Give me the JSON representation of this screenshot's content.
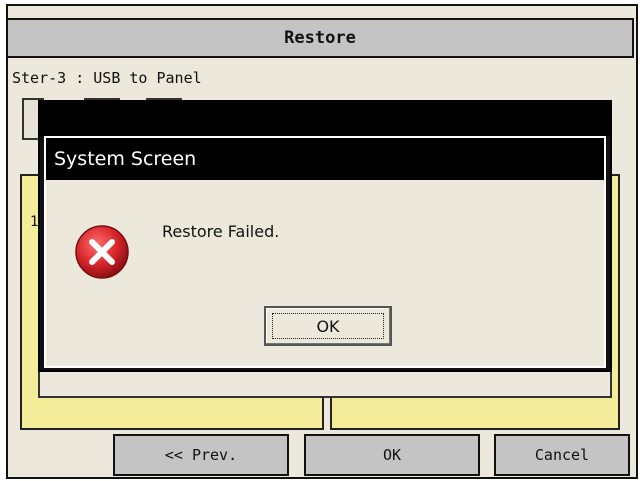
{
  "window": {
    "title": "Restore"
  },
  "step": {
    "label": "Ster-3 : USB to Panel"
  },
  "background": {
    "left_panel_glyph": "1"
  },
  "nav": {
    "prev_label": "<< Prev.",
    "ok_label": "OK",
    "cancel_label": "Cancel"
  },
  "dialog": {
    "title": "System Screen",
    "message": "Restore Failed.",
    "ok_label": "OK",
    "icon": "error-icon"
  },
  "colors": {
    "panel_yellow": "#f3ec98",
    "button_gray": "#c4c4c4",
    "dialog_title_bg": "#000000",
    "error_red": "#d8262a"
  }
}
